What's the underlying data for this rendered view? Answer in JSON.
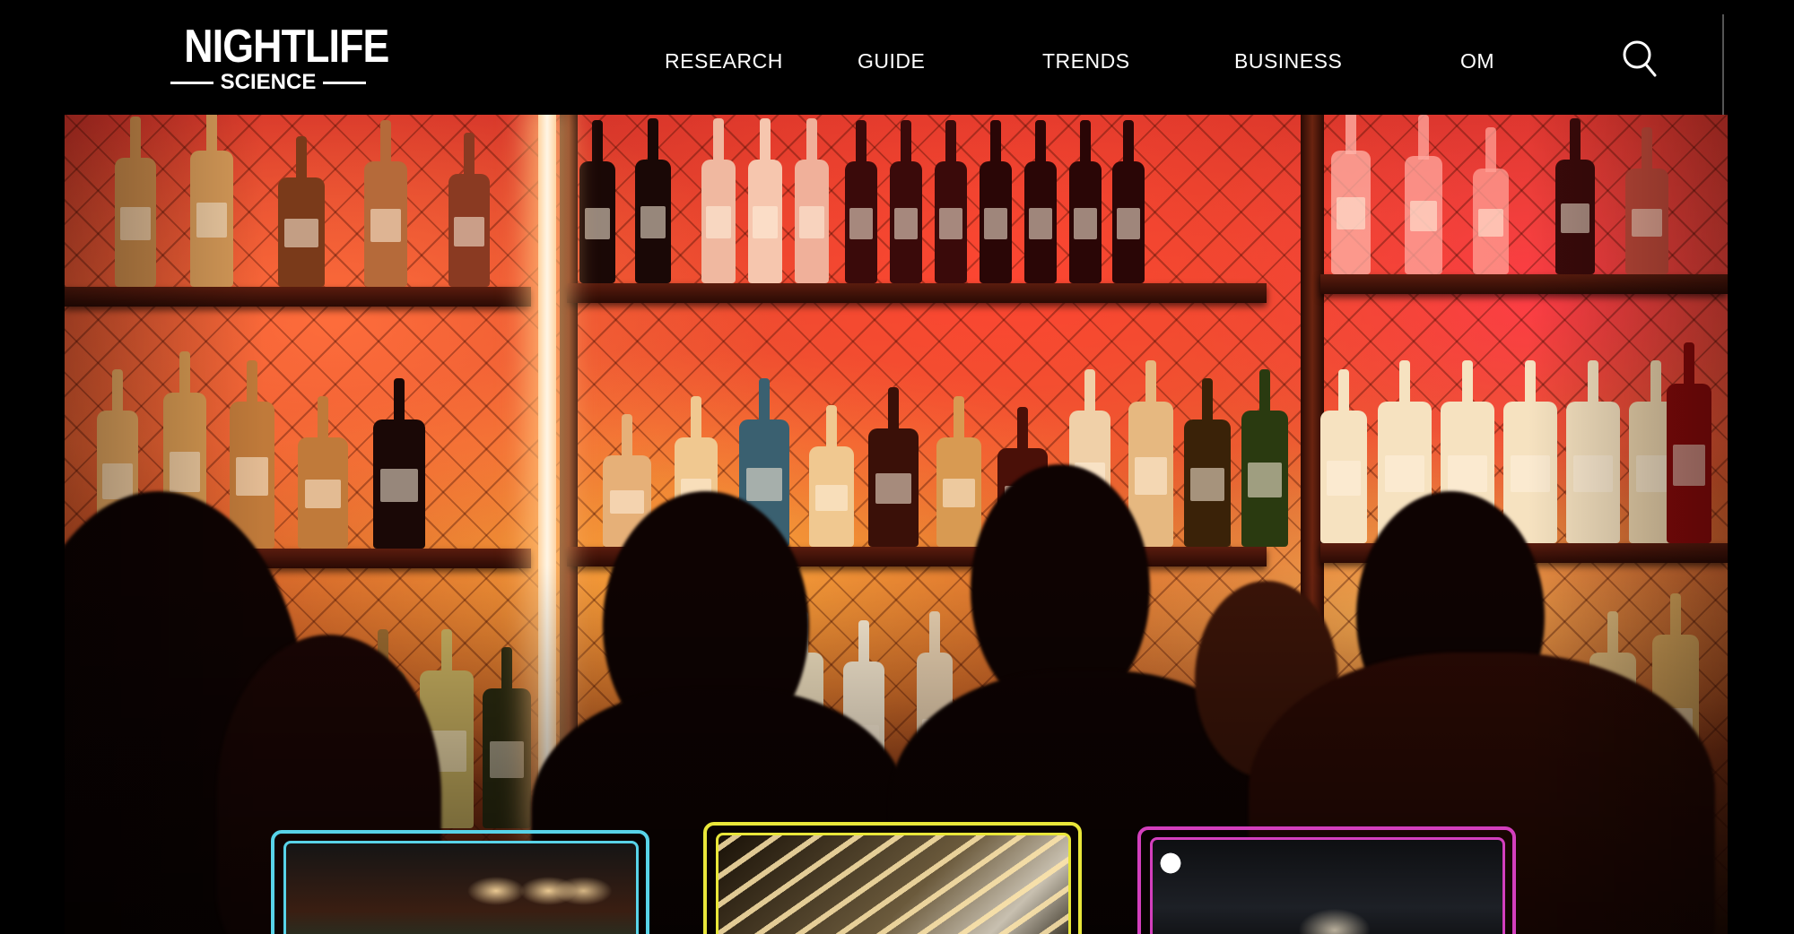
{
  "brand": {
    "logo_top": "NIGHTLIFE",
    "logo_bottom": "SCIENCE"
  },
  "nav": {
    "items": [
      {
        "label": "RESEARCH"
      },
      {
        "label": "GUIDE"
      },
      {
        "label": "TRENDS"
      },
      {
        "label": "BUSINESS"
      },
      {
        "label": "OM"
      }
    ],
    "search_icon": "search-icon"
  },
  "hero": {
    "image": "bar-counter-with-bottle-shelves-and-silhouetted-guests"
  },
  "cards": [
    {
      "image": "billiards-room-with-pendant-lamps",
      "border_color": "#58d3e8"
    },
    {
      "image": "ceiling-with-spotlights",
      "border_color": "#e8e63a"
    },
    {
      "image": "dark-lounge-interior",
      "border_color": "#d33fbd"
    }
  ],
  "colors": {
    "background": "#000000",
    "text": "#ffffff",
    "accent_cyan": "#58d3e8",
    "accent_yellow": "#e8e63a",
    "accent_magenta": "#d33fbd"
  }
}
